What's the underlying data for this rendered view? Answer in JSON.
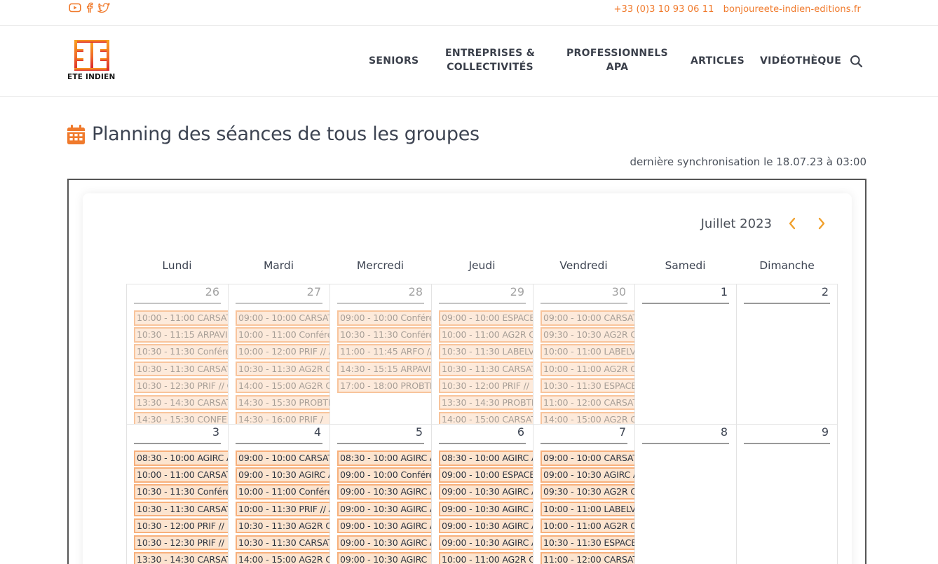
{
  "topbar": {
    "social_icons": [
      "youtube-icon",
      "facebook-icon",
      "twitter-icon"
    ],
    "phone": "+33 (0)3 10 93 06 11",
    "email": "bonjoureete-indien-editions.fr"
  },
  "brand": {
    "name": "ETE INDIEN",
    "accent": "#f07a2c"
  },
  "nav": {
    "seniors": "SENIORS",
    "entreprises_1": "ENTREPRISES &",
    "entreprises_2": "COLLECTIVITÉS",
    "pros_1": "PROFESSIONNELS",
    "pros_2": "APA",
    "articles": "ARTICLES",
    "videotheque": "VIDÉOTHÈQUE"
  },
  "page": {
    "title": "Planning des séances de tous les groupes",
    "sync": "dernière synchronisation le 18.07.23 à 03:00"
  },
  "calendar": {
    "month": "Juillet 2023",
    "weekdays": [
      "Lundi",
      "Mardi",
      "Mercredi",
      "Jeudi",
      "Vendredi",
      "Samedi",
      "Dimanche"
    ],
    "weeks": [
      {
        "days": [
          {
            "num": "26",
            "events": [
              "10:00 - 11:00 CARSAT",
              "10:30 - 11:15 ARPAVIE /",
              "10:30 - 11:30 Conférer",
              "10:30 - 11:30 CARSAT I",
              "10:30 - 12:30 PRIF // C",
              "13:30 - 14:30 CARSAT",
              "14:30 - 15:30 CONFE"
            ]
          },
          {
            "num": "27",
            "events": [
              "09:00 - 10:00 CARSAT",
              "10:00 - 11:00 Conféren",
              "10:00 - 12:00 PRIF // A",
              "10:30 - 11:30 AG2R CH",
              "14:00 - 15:00 AG2R C",
              "14:30 - 15:30 PROBTP",
              "14:30 - 16:00 PRIF /"
            ]
          },
          {
            "num": "28",
            "events": [
              "09:00 - 10:00 Confére",
              "10:30 - 11:30 Conféren",
              "11:00 - 11:45 ARFO //",
              "14:30 - 15:15 ARPAVIE",
              "17:00 - 18:00 PROBTP"
            ]
          },
          {
            "num": "29",
            "events": [
              "09:00 - 10:00 ESPACE",
              "10:00 - 11:00 AG2R CI",
              "10:30 - 11:30 LABELVI",
              "10:30 - 11:30 CARSAT I",
              "10:30 - 12:00 PRIF //",
              "13:30 - 14:30 PROBTP",
              "14:00 - 15:00 CARSAT"
            ]
          },
          {
            "num": "30",
            "events": [
              "09:00 - 10:00 CARSAT",
              "09:30 - 10:30 AG2R C",
              "10:00 - 11:00 LABELVIE",
              "10:00 - 11:00 AG2R CI",
              "10:30 - 11:30 ESPACE",
              "11:00 - 12:00 CARSAT",
              "14:00 - 15:00 AG2R C"
            ]
          },
          {
            "num": "1",
            "events": []
          },
          {
            "num": "2",
            "events": []
          }
        ]
      },
      {
        "days": [
          {
            "num": "3",
            "events": [
              "08:30 - 10:00 AGIRC A",
              "10:00 - 11:00 CARSAT",
              "10:30 - 11:30 Conférer",
              "10:30 - 11:30 CARSAT I",
              "10:30 - 12:00 PRIF //",
              "10:30 - 12:30 PRIF //",
              "13:30 - 14:30 CARSAT"
            ]
          },
          {
            "num": "4",
            "events": [
              "09:00 - 10:00 CARSAT",
              "09:00 - 10:30 AGIRC A",
              "10:00 - 11:00 Conféren",
              "10:00 - 11:30 PRIF // A",
              "10:30 - 11:30 AG2R CH",
              "10:30 - 11:30 CARSAT I",
              "14:00 - 15:00 AG2R C"
            ]
          },
          {
            "num": "5",
            "events": [
              "08:30 - 10:00 AGIRC A",
              "09:00 - 10:00 Confére",
              "09:00 - 10:30 AGIRC A",
              "09:00 - 10:30 AGIRC A",
              "09:00 - 10:30 AGIRC A",
              "09:00 - 10:30 AGIRC A",
              "09:00 - 10:30 AGIRC"
            ]
          },
          {
            "num": "6",
            "events": [
              "08:30 - 10:00 AGIRC A",
              "09:00 - 10:00 ESPACE",
              "09:00 - 10:30 AGIRC A",
              "09:00 - 10:30 AGIRC A",
              "09:00 - 10:30 AGIRC A",
              "09:00 - 10:30 AGIRC A",
              "10:00 - 11:00 AG2R CI"
            ]
          },
          {
            "num": "7",
            "events": [
              "09:00 - 10:00 CARSAT",
              "09:00 - 10:30 AGIRC A",
              "09:30 - 10:30 AG2R C",
              "10:00 - 11:00 LABELVIE",
              "10:00 - 11:00 AG2R CI",
              "10:30 - 11:30 ESPACE",
              "11:00 - 12:00 CARSAT"
            ]
          },
          {
            "num": "8",
            "events": []
          },
          {
            "num": "9",
            "events": []
          }
        ]
      }
    ]
  }
}
